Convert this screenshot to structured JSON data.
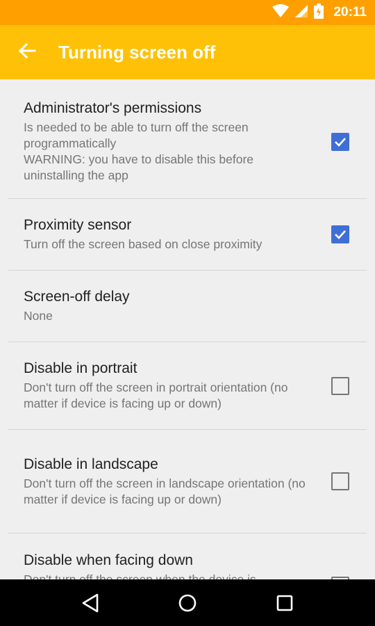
{
  "status_bar": {
    "time": "20:11"
  },
  "app_bar": {
    "title": "Turning screen off",
    "back_icon": "arrow-left-icon"
  },
  "preferences": [
    {
      "title": "Administrator's permissions",
      "summary": "Is needed to be able to turn off the screen programmatically\nWARNING: you have to disable this before uninstalling the app",
      "checkbox": true,
      "checked": true
    },
    {
      "title": "Proximity sensor",
      "summary": "Turn off the screen based on close proximity",
      "checkbox": true,
      "checked": true
    },
    {
      "title": "Screen-off delay",
      "summary": "None",
      "checkbox": false,
      "checked": false
    },
    {
      "title": "Disable in portrait",
      "summary": "Don't turn off the screen in portrait orientation (no matter if device is facing up or down)",
      "checkbox": true,
      "checked": false
    },
    {
      "title": "Disable in landscape",
      "summary": "Don't turn off the screen in landscape orientation (no matter if device is facing up or down)",
      "checkbox": true,
      "checked": false
    },
    {
      "title": "Disable when facing down",
      "summary": "Don't turn off the screen when the device is",
      "checkbox": true,
      "checked": false
    }
  ],
  "colors": {
    "status_bar": "#ffa000",
    "app_bar": "#ffc107",
    "checkbox_accent": "#3f6fd6"
  },
  "nav_bar": {
    "icons": [
      "back-triangle-icon",
      "home-circle-icon",
      "recents-square-icon"
    ]
  }
}
